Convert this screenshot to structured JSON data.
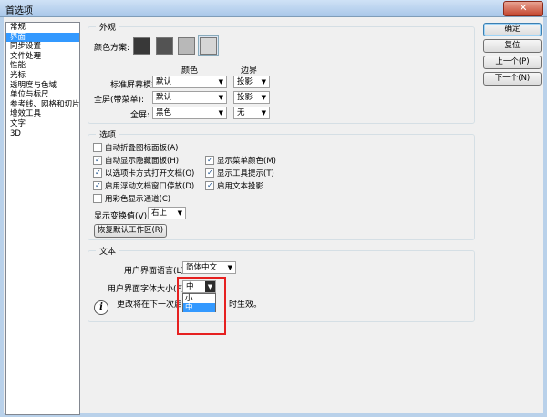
{
  "window": {
    "title": "首选项",
    "close_glyph": "✕"
  },
  "sidebar": {
    "items": [
      "常规",
      "界面",
      "同步设置",
      "文件处理",
      "性能",
      "光标",
      "透明度与色域",
      "单位与标尺",
      "参考线、网格和切片",
      "增效工具",
      "文字",
      "3D"
    ],
    "selected_index": 1
  },
  "appearance": {
    "legend": "外观",
    "color_scheme_label": "颜色方案:",
    "swatch_colors": [
      "#383838",
      "#535353",
      "#b8b8b8",
      "#d6d6d6"
    ],
    "selected_swatch_index": 3,
    "col_color": "颜色",
    "col_border": "边界",
    "rows": [
      {
        "label": "标准屏幕模式:",
        "color": "默认",
        "border": "投影"
      },
      {
        "label": "全屏(带菜单):",
        "color": "默认",
        "border": "投影"
      },
      {
        "label": "全屏:",
        "color": "黑色",
        "border": "无"
      }
    ]
  },
  "options": {
    "legend": "选项",
    "left_checks": [
      {
        "label": "自动折叠图标面板(A)",
        "checked": false
      },
      {
        "label": "自动显示隐藏面板(H)",
        "checked": true
      },
      {
        "label": "以选项卡方式打开文档(O)",
        "checked": true
      },
      {
        "label": "启用浮动文档窗口停放(D)",
        "checked": true
      },
      {
        "label": "用彩色显示通道(C)",
        "checked": false
      }
    ],
    "right_checks": [
      {
        "label": "显示菜单颜色(M)",
        "checked": true
      },
      {
        "label": "显示工具提示(T)",
        "checked": true
      },
      {
        "label": "启用文本投影",
        "checked": true
      }
    ],
    "transform_label": "显示变换值(V):",
    "transform_value": "右上",
    "restore_button": "恢复默认工作区(R)"
  },
  "text": {
    "legend": "文本",
    "language_label": "用户界面语言(L):",
    "language_value": "简体中文",
    "font_size_label": "用户界面字体大小(F):",
    "font_size_value": "中",
    "font_size_options": [
      "小",
      "中"
    ],
    "font_size_highlight_index": 1,
    "info_icon": "i",
    "note_start": "更改将在下一次启",
    "note_end": "时生效。"
  },
  "buttons": {
    "ok": "确定",
    "reset": "复位",
    "prev": "上一个(P)",
    "next": "下一个(N)"
  },
  "accent": {
    "highlight": "#3399ff",
    "annotation_red": "#e62020"
  }
}
